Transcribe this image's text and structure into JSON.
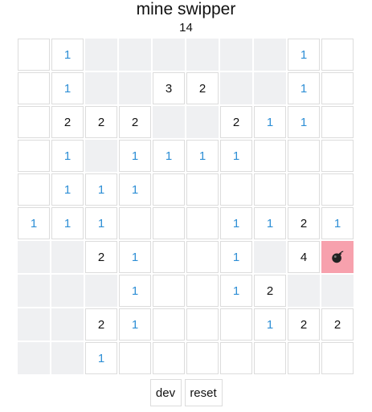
{
  "title": "mine swipper",
  "counter": "14",
  "buttons": {
    "dev_label": "dev",
    "reset_label": "reset"
  },
  "colors": {
    "number_1": "#2e8fd6",
    "number_other": "#111111",
    "hidden_cell": "#eff0f2",
    "mine_cell": "#f7a1ad"
  },
  "board": [
    [
      "",
      "1",
      "H",
      "H",
      "H",
      "H",
      "H",
      "H",
      "1",
      ""
    ],
    [
      "",
      "1",
      "H",
      "H",
      "3",
      "2",
      "H",
      "H",
      "1",
      ""
    ],
    [
      "",
      "2",
      "2",
      "2",
      "H",
      "H",
      "2",
      "1",
      "1",
      ""
    ],
    [
      "",
      "1",
      "H",
      "1",
      "1",
      "1",
      "1",
      "",
      "",
      ""
    ],
    [
      "",
      "1",
      "1",
      "1",
      "",
      "",
      "",
      "",
      "",
      ""
    ],
    [
      "1",
      "1",
      "1",
      "",
      "",
      "",
      "1",
      "1",
      "2",
      "1"
    ],
    [
      "H",
      "H",
      "2",
      "1",
      "",
      "",
      "1",
      "H",
      "4",
      "M"
    ],
    [
      "H",
      "H",
      "H",
      "1",
      "",
      "",
      "1",
      "2",
      "H",
      "H"
    ],
    [
      "H",
      "H",
      "2",
      "1",
      "",
      "",
      "",
      "1",
      "2",
      "2"
    ],
    [
      "H",
      "H",
      "1",
      "",
      "",
      "",
      "",
      "",
      "",
      ""
    ]
  ]
}
